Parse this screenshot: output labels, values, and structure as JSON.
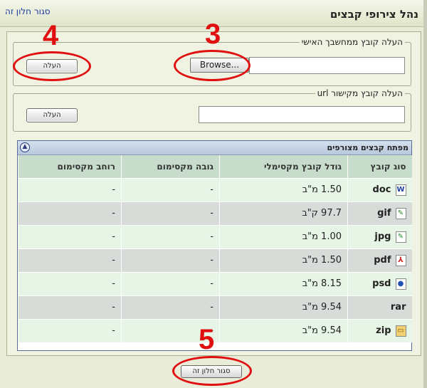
{
  "window": {
    "title": "נהל צירופי קבצים",
    "close_link": "סגור חלון זה"
  },
  "upload_local": {
    "legend": "העלה קובץ ממחשבך האישי",
    "browse_label": "Browse...",
    "upload_label": "העלה"
  },
  "upload_url": {
    "legend": "העלה קובץ מקישור url",
    "upload_label": "העלה"
  },
  "key_table": {
    "title": "מפתח קבצים מצורפים",
    "headers": [
      "סוג קובץ",
      "גודל קובץ מקסימלי",
      "גובה מקסימום",
      "רוחב מקסימום"
    ],
    "rows": [
      {
        "type": "doc",
        "icon": "word-doc-icon",
        "size": "1.50 מ\"ב",
        "height": "-",
        "width": "-"
      },
      {
        "type": "gif",
        "icon": "image-file-icon",
        "size": "97.7 ק\"ב",
        "height": "-",
        "width": "-"
      },
      {
        "type": "jpg",
        "icon": "image-file-icon",
        "size": "1.00 מ\"ב",
        "height": "-",
        "width": "-"
      },
      {
        "type": "pdf",
        "icon": "pdf-file-icon",
        "size": "1.50 מ\"ב",
        "height": "-",
        "width": "-"
      },
      {
        "type": "psd",
        "icon": "photoshop-file-icon",
        "size": "8.15 מ\"ב",
        "height": "-",
        "width": "-"
      },
      {
        "type": "rar",
        "icon": "",
        "size": "9.54 מ\"ב",
        "height": "-",
        "width": "-"
      },
      {
        "type": "zip",
        "icon": "zip-file-icon",
        "size": "9.54 מ\"ב",
        "height": "-",
        "width": "-"
      }
    ]
  },
  "footer": {
    "close_button": "סגור חלון זה"
  },
  "annotations": {
    "n3": "3",
    "n4": "4",
    "n5": "5"
  },
  "colors": {
    "annotation_red": "#e01010",
    "header_green": "#c8dccc",
    "link_blue": "#1a3aa0"
  }
}
